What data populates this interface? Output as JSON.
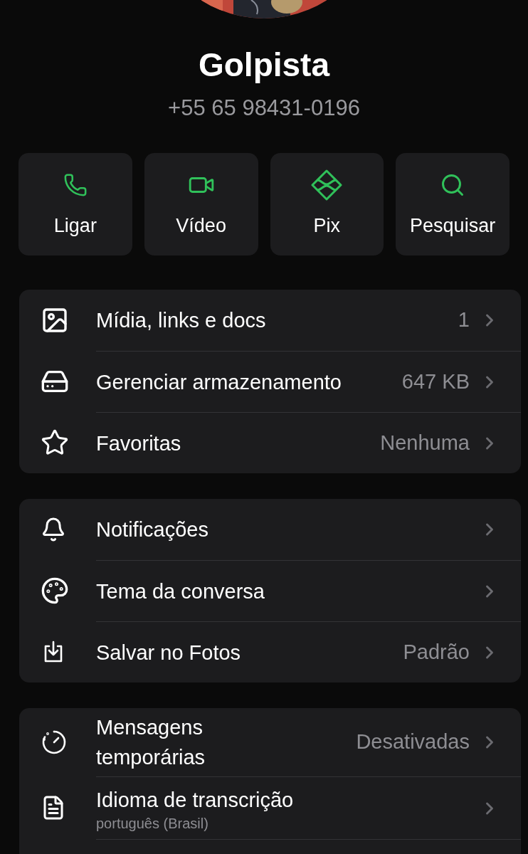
{
  "contact": {
    "name": "Golpista",
    "phone": "+55 65 98431-0196"
  },
  "actions": [
    {
      "label": "Ligar"
    },
    {
      "label": "Vídeo"
    },
    {
      "label": "Pix"
    },
    {
      "label": "Pesquisar"
    }
  ],
  "sections": [
    {
      "rows": [
        {
          "title": "Mídia, links e docs",
          "value": "1"
        },
        {
          "title": "Gerenciar armazenamento",
          "value": "647 KB"
        },
        {
          "title": "Favoritas",
          "value": "Nenhuma"
        }
      ]
    },
    {
      "rows": [
        {
          "title": "Notificações"
        },
        {
          "title": "Tema da conversa"
        },
        {
          "title": "Salvar no Fotos",
          "value": "Padrão"
        }
      ]
    },
    {
      "rows": [
        {
          "title": "Mensagens temporárias",
          "value": "Desativadas"
        },
        {
          "title": "Idioma de transcrição",
          "subtitle": "português (Brasil)"
        }
      ]
    }
  ]
}
